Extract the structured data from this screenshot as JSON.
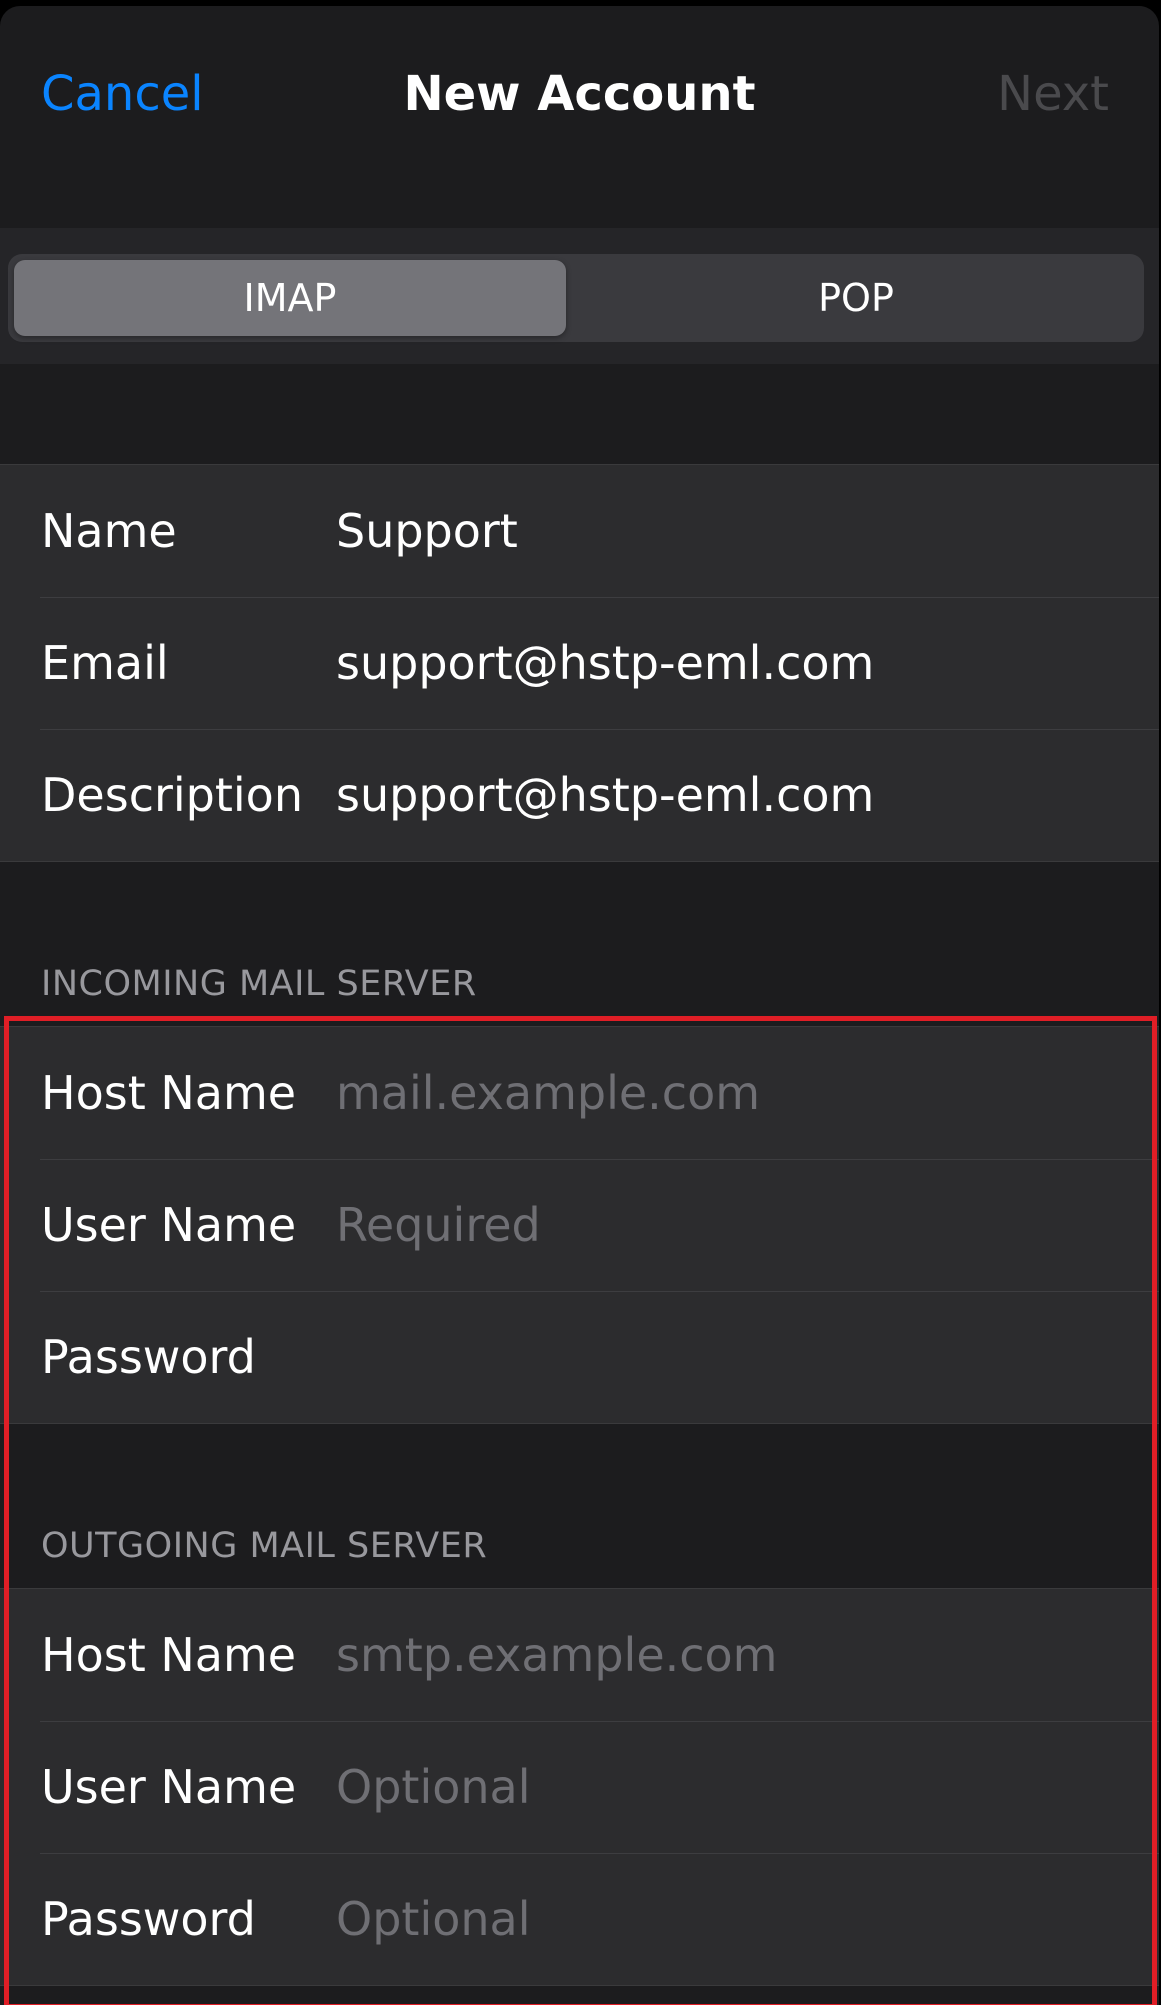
{
  "navbar": {
    "cancel_label": "Cancel",
    "title": "New Account",
    "next_label": "Next"
  },
  "account_type": {
    "options": [
      "IMAP",
      "POP"
    ],
    "selected": "IMAP"
  },
  "account_info": {
    "rows": [
      {
        "label": "Name",
        "value": "Support",
        "placeholder": ""
      },
      {
        "label": "Email",
        "value": "support@hstp-eml.com",
        "placeholder": ""
      },
      {
        "label": "Description",
        "value": "support@hstp-eml.com",
        "placeholder": ""
      }
    ]
  },
  "incoming_server": {
    "header": "INCOMING MAIL SERVER",
    "rows": [
      {
        "label": "Host Name",
        "value": "",
        "placeholder": "mail.example.com"
      },
      {
        "label": "User Name",
        "value": "",
        "placeholder": "Required"
      },
      {
        "label": "Password",
        "value": "",
        "placeholder": ""
      }
    ]
  },
  "outgoing_server": {
    "header": "OUTGOING MAIL SERVER",
    "rows": [
      {
        "label": "Host Name",
        "value": "",
        "placeholder": "smtp.example.com"
      },
      {
        "label": "User Name",
        "value": "",
        "placeholder": "Optional"
      },
      {
        "label": "Password",
        "value": "",
        "placeholder": "Optional"
      }
    ]
  },
  "colors": {
    "accent": "#0a84ff",
    "disabled": "#4a4a4d",
    "background": "#1c1c1e",
    "cell": "#2c2c2e",
    "highlight": "#e01e26"
  }
}
